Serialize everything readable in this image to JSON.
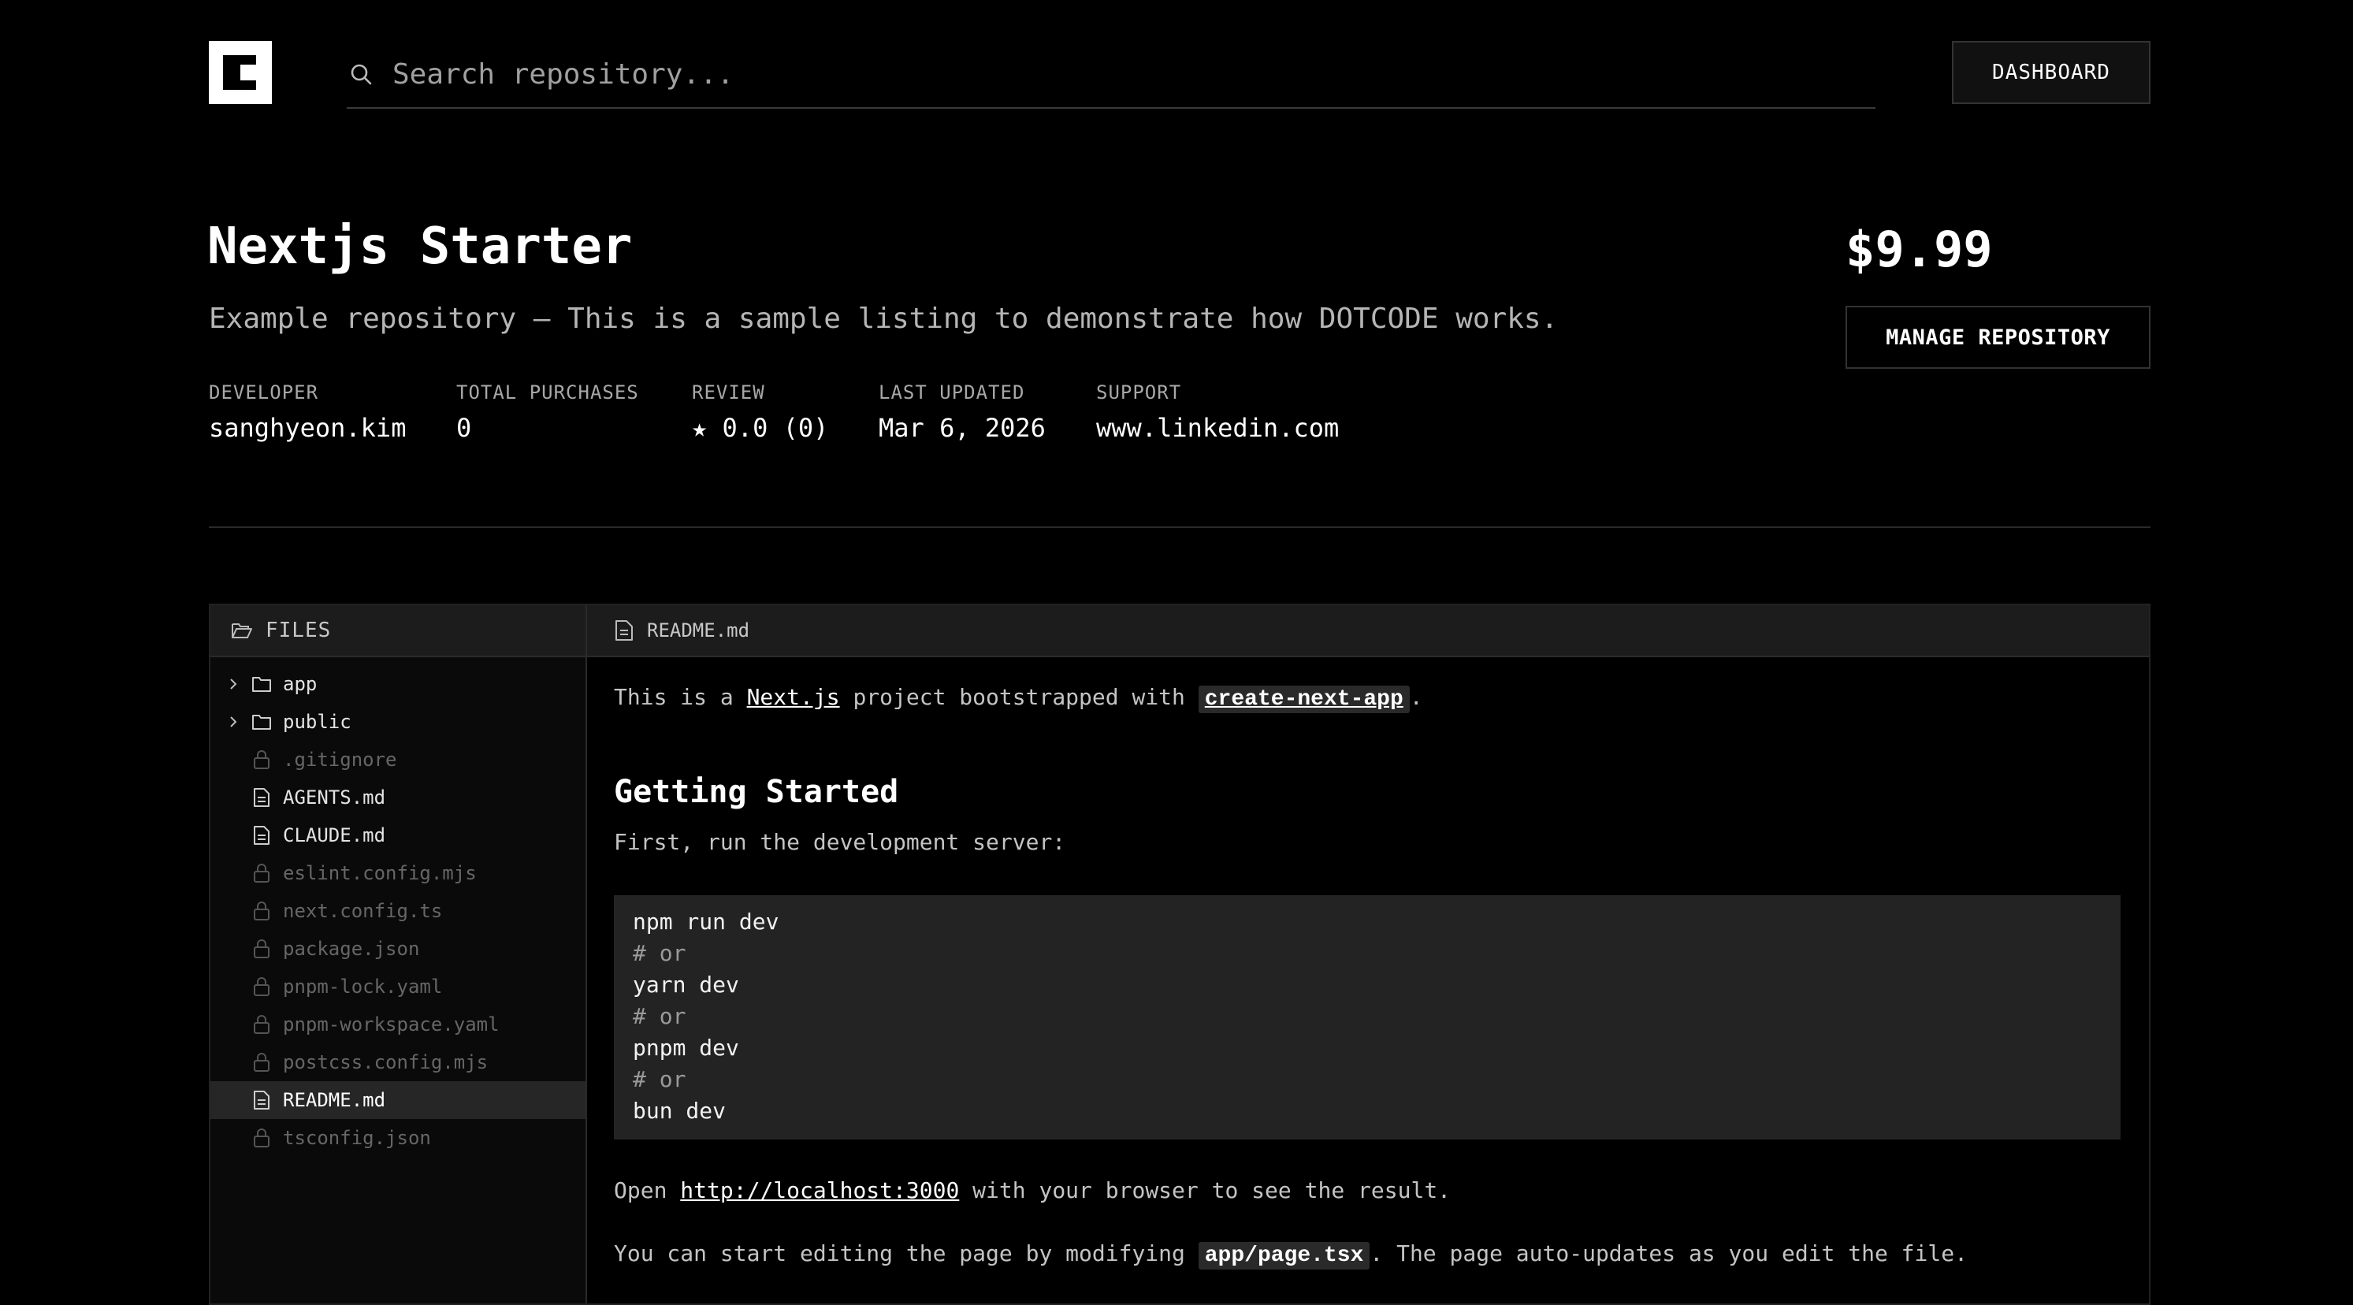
{
  "header": {
    "search_placeholder": "Search repository...",
    "dashboard_label": "DASHBOARD"
  },
  "repo": {
    "title": "Nextjs Starter",
    "description": "Example repository — This is a sample listing to demonstrate how DOTCODE works.",
    "price": "$9.99",
    "manage_label": "MANAGE REPOSITORY",
    "meta": [
      {
        "label": "DEVELOPER",
        "value": "sanghyeon.kim"
      },
      {
        "label": "TOTAL PURCHASES",
        "value": "0"
      },
      {
        "label": "REVIEW",
        "value": "★ 0.0 (0)"
      },
      {
        "label": "LAST UPDATED",
        "value": "Mar 6, 2026"
      },
      {
        "label": "SUPPORT",
        "value": "www.linkedin.com"
      }
    ]
  },
  "files": {
    "header_label": "FILES",
    "items": [
      {
        "name": "app",
        "kind": "folder"
      },
      {
        "name": "public",
        "kind": "folder"
      },
      {
        "name": ".gitignore",
        "kind": "locked"
      },
      {
        "name": "AGENTS.md",
        "kind": "file"
      },
      {
        "name": "CLAUDE.md",
        "kind": "file"
      },
      {
        "name": "eslint.config.mjs",
        "kind": "locked"
      },
      {
        "name": "next.config.ts",
        "kind": "locked"
      },
      {
        "name": "package.json",
        "kind": "locked"
      },
      {
        "name": "pnpm-lock.yaml",
        "kind": "locked"
      },
      {
        "name": "pnpm-workspace.yaml",
        "kind": "locked"
      },
      {
        "name": "postcss.config.mjs",
        "kind": "locked"
      },
      {
        "name": "README.md",
        "kind": "file",
        "active": true
      },
      {
        "name": "tsconfig.json",
        "kind": "locked"
      }
    ]
  },
  "readme": {
    "tab_label": "README.md",
    "intro": {
      "prefix": "This is a ",
      "link1": "Next.js",
      "middle": " project bootstrapped with ",
      "code1": "create-next-app",
      "suffix": "."
    },
    "heading": "Getting Started",
    "step": "First, run the development server:",
    "code_lines": [
      {
        "text": "npm run dev",
        "comment": false
      },
      {
        "text": "# or",
        "comment": true
      },
      {
        "text": "yarn dev",
        "comment": false
      },
      {
        "text": "# or",
        "comment": true
      },
      {
        "text": "pnpm dev",
        "comment": false
      },
      {
        "text": "# or",
        "comment": true
      },
      {
        "text": "bun dev",
        "comment": false
      }
    ],
    "open": {
      "prefix": "Open ",
      "link": "http://localhost:3000",
      "suffix": " with your browser to see the result."
    },
    "edit": {
      "prefix": "You can start editing the page by modifying ",
      "code": "app/page.tsx",
      "suffix": ". The page auto-updates as you edit the file."
    }
  }
}
